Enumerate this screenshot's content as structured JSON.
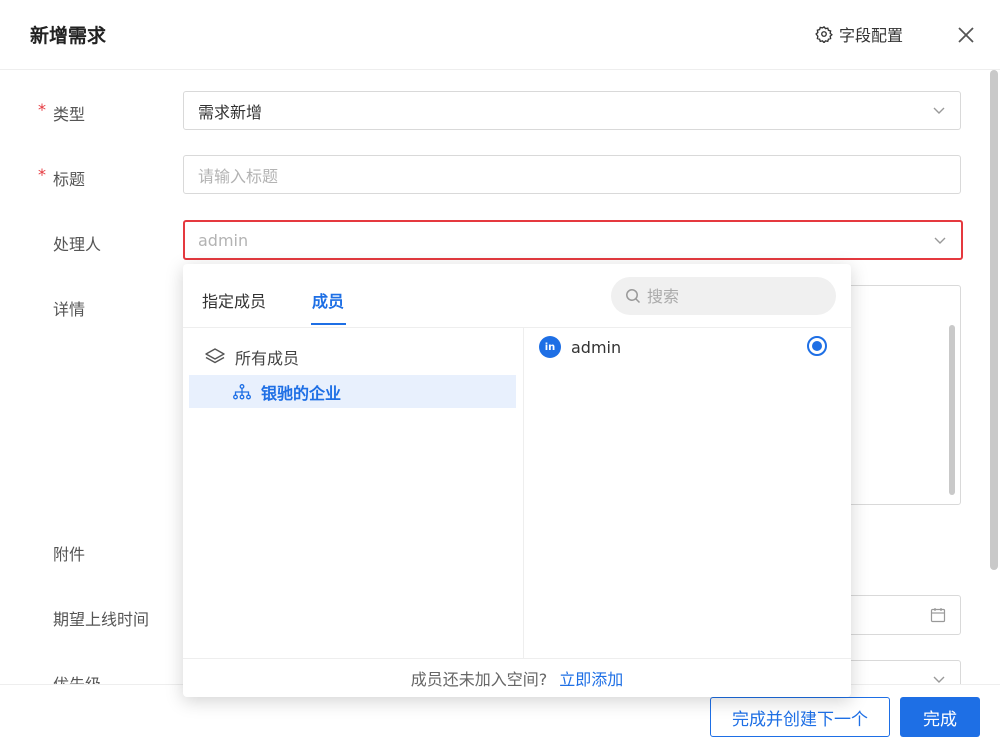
{
  "header": {
    "title": "新增需求",
    "field_config_label": "字段配置"
  },
  "form": {
    "type": {
      "label": "类型",
      "value": "需求新增"
    },
    "title": {
      "label": "标题",
      "placeholder": "请输入标题"
    },
    "assignee": {
      "label": "处理人",
      "placeholder": "admin"
    },
    "details": {
      "label": "详情"
    },
    "attachment": {
      "label": "附件"
    },
    "expected_date": {
      "label": "期望上线时间"
    },
    "priority": {
      "label": "优先级"
    },
    "required_mark": "*"
  },
  "dropdown": {
    "tabs": [
      {
        "label": "指定成员"
      },
      {
        "label": "成员"
      }
    ],
    "active_tab": "成员",
    "search_placeholder": "搜索",
    "tree": {
      "all_members": "所有成员",
      "org": "银驰的企业"
    },
    "members": [
      {
        "avatar_text": "in",
        "name": "admin",
        "selected": true
      }
    ],
    "footer": {
      "question": "成员还未加入空间?",
      "link": "立即添加"
    }
  },
  "footer": {
    "create_next_label": "完成并创建下一个",
    "done_label": "完成"
  },
  "colors": {
    "primary": "#1e6fe5",
    "required": "#e5393f",
    "highlight_border": "#e5393f"
  }
}
